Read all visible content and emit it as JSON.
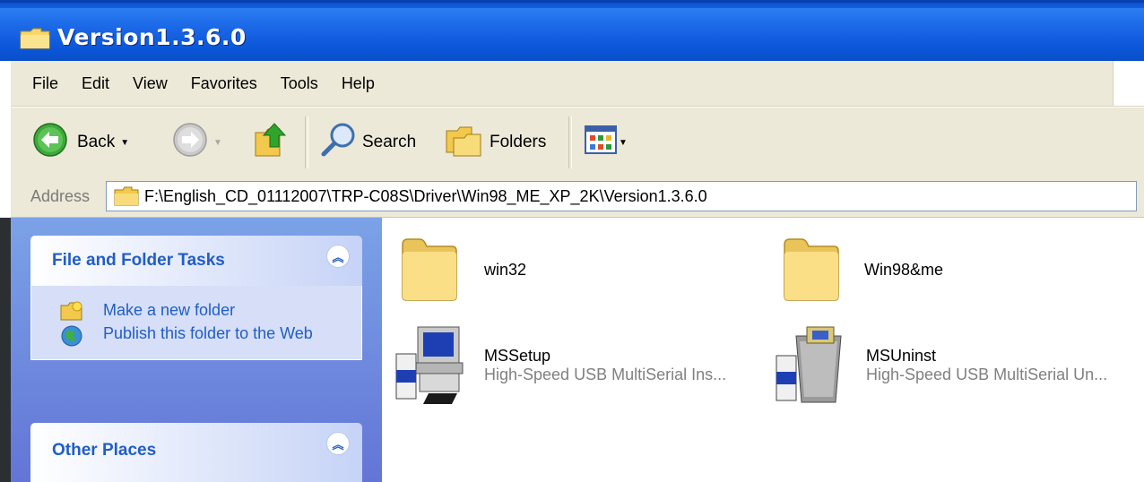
{
  "window": {
    "title": "Version1.3.6.0"
  },
  "menu": [
    "File",
    "Edit",
    "View",
    "Favorites",
    "Tools",
    "Help"
  ],
  "toolbar": {
    "back_label": "Back",
    "search_label": "Search",
    "folders_label": "Folders"
  },
  "address": {
    "label": "Address",
    "path": "F:\\English_CD_01112007\\TRP-C08S\\Driver\\Win98_ME_XP_2K\\Version1.3.6.0"
  },
  "tasks": {
    "file_folder": {
      "title": "File and Folder Tasks",
      "items": [
        "Make a new folder",
        "Publish this folder to the Web"
      ]
    },
    "other_places": {
      "title": "Other Places"
    }
  },
  "files": [
    {
      "name": "win32",
      "icon": "folder-icon"
    },
    {
      "name": "Win98&me",
      "icon": "folder-icon"
    },
    {
      "name": "MSSetup",
      "description": "High-Speed USB MultiSerial Ins...",
      "icon": "setup-program-icon"
    },
    {
      "name": "MSUninst",
      "description": "High-Speed USB MultiSerial Un...",
      "icon": "uninstall-program-icon"
    }
  ],
  "colors": {
    "title_bar": "#0a5be0",
    "task_pane": "#7ba2e7",
    "task_link": "#215dc6",
    "chrome": "#ece9d8"
  }
}
